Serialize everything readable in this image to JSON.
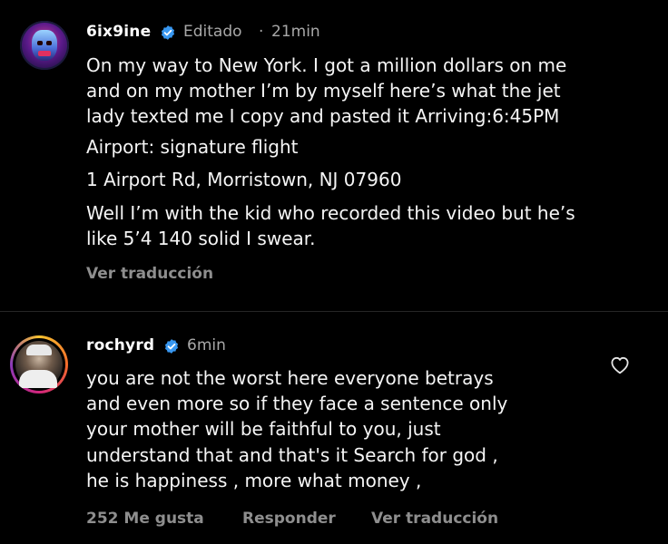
{
  "post": {
    "username": "6ix9ine",
    "edited": "Editado",
    "separator": "·",
    "time": "21min",
    "lines": [
      "On my way to New York. I got a million dollars on me",
      "and on my mother I’m by myself here’s what the jet",
      "lady texted me I copy and pasted it Arriving:6:45PM",
      "Airport: signature flight",
      "1 Airport Rd, Morristown, NJ 07960",
      "Well I’m with the kid who recorded this video but he’s",
      "like 5’4 140 solid I swear."
    ],
    "translate_label": "Ver traducción"
  },
  "comment": {
    "username": "rochyrd",
    "time": "6min",
    "lines": [
      "you are not the worst here everyone betrays",
      "and even more so if they face a sentence only",
      "your mother will be faithful to you, just",
      "understand that and that's it Search for god ,",
      "he is happiness , more what money ,"
    ],
    "likes_label": "252 Me gusta",
    "reply_label": "Responder",
    "translate_label": "Ver traducción"
  },
  "colors": {
    "background": "#000000",
    "verified_badge": "#3897f0",
    "secondary_text": "#a8a8a8"
  },
  "icons": {
    "verified": "verified-badge-icon",
    "like": "heart-outline-icon"
  }
}
